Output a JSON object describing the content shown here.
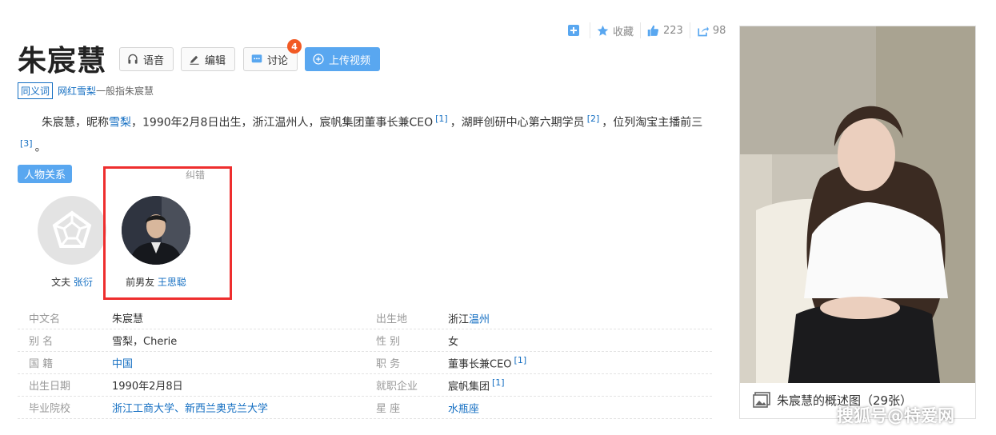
{
  "toolbar": {
    "collect_label": "收藏",
    "like_count": "223",
    "share_count": "98"
  },
  "title": "朱宸慧",
  "buttons": {
    "voice": "语音",
    "edit": "编辑",
    "discuss": "讨论",
    "discuss_badge": "4",
    "upload": "上传视频"
  },
  "synonym": {
    "tag": "同义词",
    "link": "网红雪梨",
    "rest": "一般指朱宸慧"
  },
  "summary": {
    "p1": "朱宸慧，昵称",
    "link1": "雪梨",
    "p2": "，1990年2月8日出生，浙江温州人，宸帆集团董事长兼CEO",
    "ref1": "[1]",
    "p3": "，湖畔创研中心第六期学员",
    "ref2": "[2]",
    "p4": "，位列淘宝主播前三",
    "ref3": "[3]",
    "p5": "。"
  },
  "relations": {
    "tag": "人物关系",
    "correction": "纠错",
    "people": [
      {
        "relation": "文夫",
        "name": "张衍"
      },
      {
        "relation": "前男友",
        "name": "王思聪"
      }
    ]
  },
  "info": {
    "rows": [
      {
        "k1": "中文名",
        "v1": "朱宸慧",
        "v1_link": "",
        "k2": "出生地",
        "v2": "浙江",
        "v2_link": "温州",
        "v2_ref": ""
      },
      {
        "k1": "别    名",
        "v1": "雪梨，Cherie",
        "v1_link": "",
        "k2": "性    别",
        "v2": "女",
        "v2_link": "",
        "v2_ref": ""
      },
      {
        "k1": "国    籍",
        "v1": "",
        "v1_link": "中国",
        "k2": "职    务",
        "v2": "董事长兼CEO",
        "v2_link": "",
        "v2_ref": "[1]"
      },
      {
        "k1": "出生日期",
        "v1": "1990年2月8日",
        "v1_link": "",
        "k2": "就职企业",
        "v2": "宸帆集团",
        "v2_link": "",
        "v2_ref": "[1]"
      },
      {
        "k1": "毕业院校",
        "v1": "",
        "v1_link": "浙江工商大学、新西兰奥克兰大学",
        "k2": "星    座",
        "v2": "",
        "v2_link": "水瓶座",
        "v2_ref": ""
      }
    ]
  },
  "photo": {
    "caption": "朱宸慧的概述图（29张）"
  },
  "watermark": "搜狐号@特爱网",
  "colors": {
    "link": "#136ec2",
    "accent": "#59a7f0",
    "badge": "#f25a24",
    "highlight": "#ee2e2e"
  }
}
